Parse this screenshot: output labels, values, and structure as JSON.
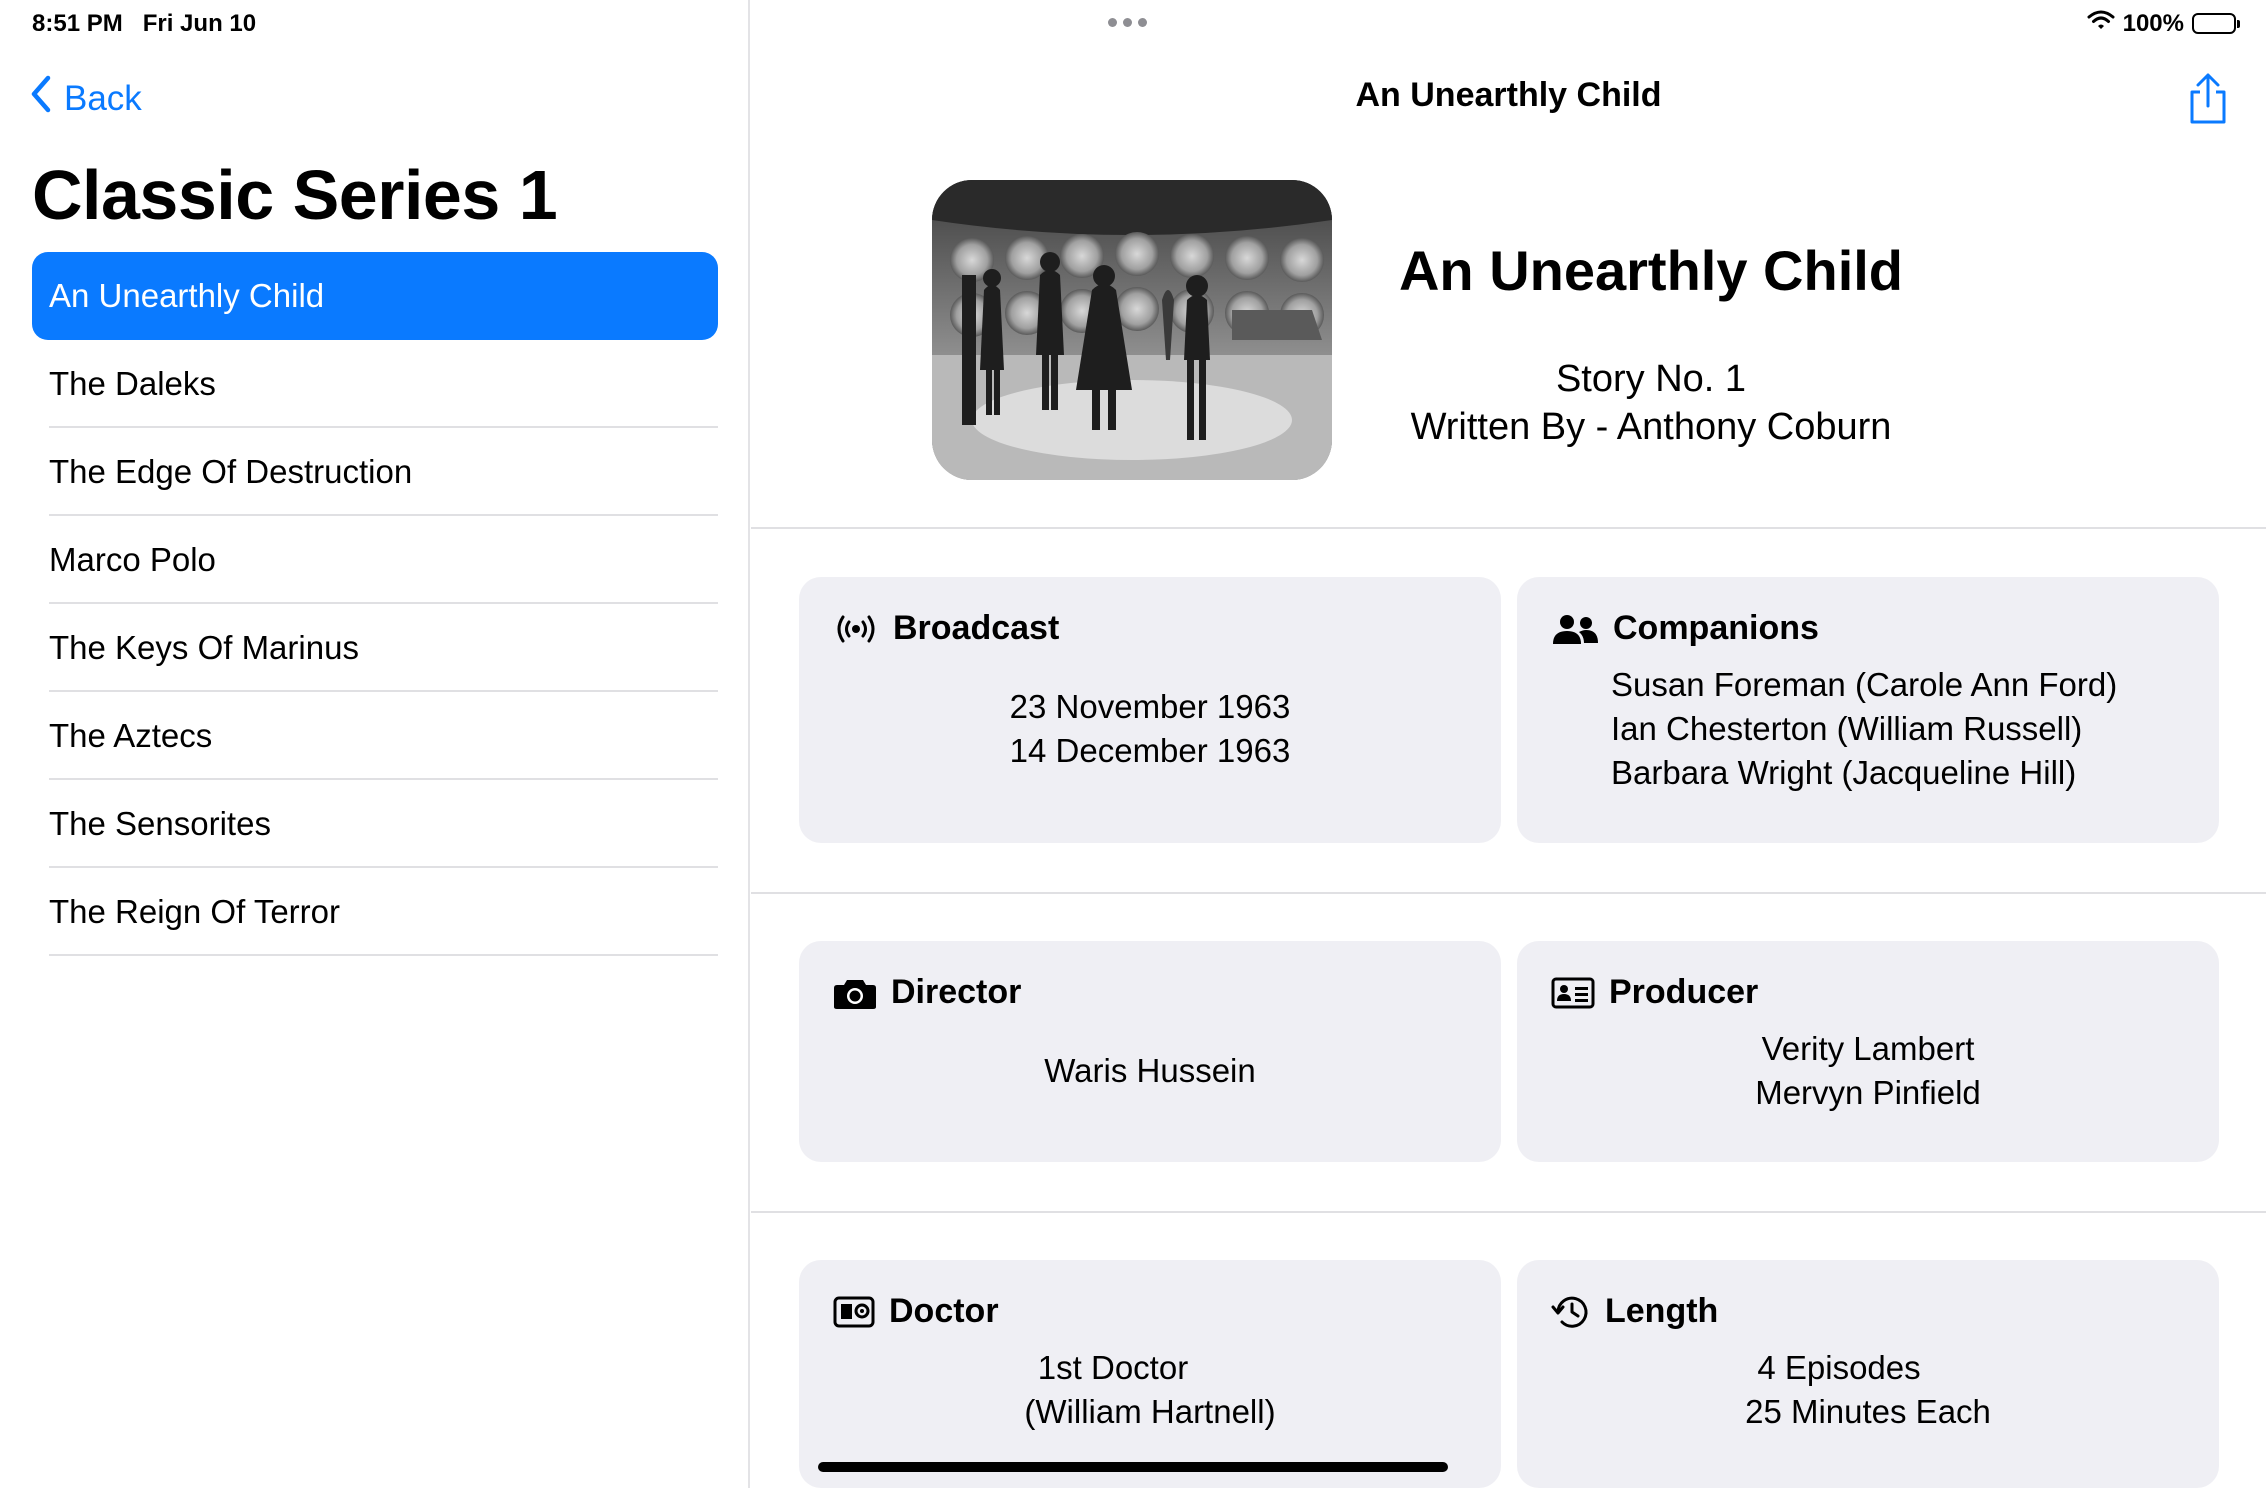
{
  "status": {
    "time": "8:51 PM",
    "date": "Fri Jun 10",
    "battery": "100%"
  },
  "sidebar": {
    "back_label": "Back",
    "title": "Classic Series 1",
    "episodes": [
      "An Unearthly Child",
      "The Daleks",
      "The Edge Of Destruction",
      "Marco Polo",
      "The Keys Of Marinus",
      "The Aztecs",
      "The Sensorites",
      "The Reign Of Terror"
    ],
    "selected_index": 0
  },
  "detail": {
    "nav_title": "An Unearthly Child",
    "title": "An Unearthly Child",
    "story_no": "Story No. 1",
    "written_by": "Written By - Anthony Coburn",
    "broadcast": {
      "label": "Broadcast",
      "lines": [
        "23 November 1963",
        "14 December 1963"
      ]
    },
    "companions": {
      "label": "Companions",
      "lines": [
        "Susan Foreman (Carole Ann Ford)",
        "Ian Chesterton (William Russell)",
        "Barbara Wright (Jacqueline Hill)"
      ]
    },
    "director": {
      "label": "Director",
      "lines": [
        "Waris Hussein"
      ]
    },
    "producer": {
      "label": "Producer",
      "lines": [
        "Verity Lambert",
        "Mervyn Pinfield"
      ]
    },
    "doctor": {
      "label": "Doctor",
      "lines": [
        "1st Doctor",
        "(William Hartnell)"
      ]
    },
    "length": {
      "label": "Length",
      "lines": [
        "4 Episodes",
        "25 Minutes Each"
      ]
    }
  },
  "icons": {
    "back": "chevron-left-icon",
    "share": "share-icon",
    "broadcast": "antenna-waves-icon",
    "companions": "people-icon",
    "director": "camera-icon",
    "producer": "person-card-icon",
    "doctor": "person-badge-icon",
    "length": "clock-history-icon"
  },
  "colors": {
    "accent": "#0a7aff",
    "card": "#efeff4",
    "divider": "#e0e0e3"
  }
}
